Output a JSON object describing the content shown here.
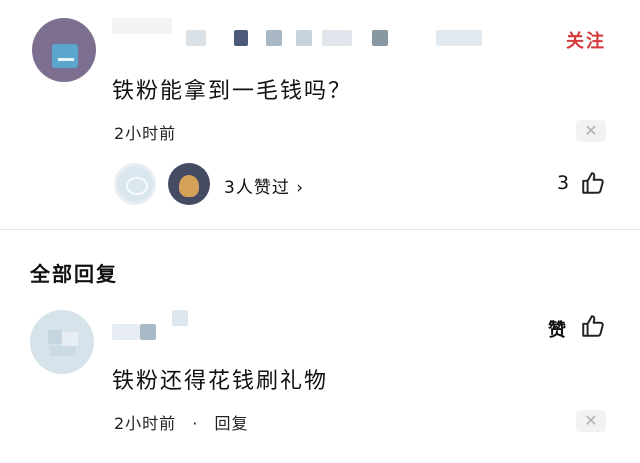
{
  "post": {
    "follow_label": "关注",
    "content": "铁粉能拿到一毛钱吗？",
    "time": "2小时前",
    "likers_text": "3人赞过 ›",
    "like_count": "3"
  },
  "replies_section": {
    "title": "全部回复"
  },
  "reply": {
    "like_label": "赞",
    "content": "铁粉还得花钱刷礼物",
    "time": "2小时前",
    "separator": "·",
    "reply_label": "回复"
  },
  "icons": {
    "close": "close-icon",
    "thumb": "thumbs-up-icon",
    "close_glyph": "✕"
  }
}
